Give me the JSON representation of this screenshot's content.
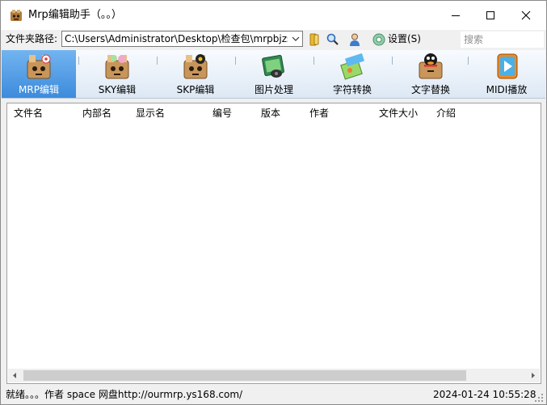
{
  "window": {
    "title": "Mrp编辑助手（。。）",
    "icon": "mrp-app-icon"
  },
  "pathbar": {
    "label": "文件夹路径:",
    "path_value": "C:\\Users\\Administrator\\Desktop\\检查包\\mrpbjzs",
    "settings_label": "设置(S)",
    "search_placeholder": "搜索"
  },
  "toolbar": {
    "items": [
      {
        "label": "MRP编辑",
        "icon": "mrp-edit-icon",
        "active": true
      },
      {
        "label": "SKY编辑",
        "icon": "sky-edit-icon",
        "active": false
      },
      {
        "label": "SKP编辑",
        "icon": "skp-edit-icon",
        "active": false
      },
      {
        "label": "图片处理",
        "icon": "image-process-icon",
        "active": false
      },
      {
        "label": "字符转换",
        "icon": "char-convert-icon",
        "active": false
      },
      {
        "label": "文字替换",
        "icon": "text-replace-icon",
        "active": false
      },
      {
        "label": "MIDI播放",
        "icon": "midi-play-icon",
        "active": false
      }
    ]
  },
  "list": {
    "columns": [
      "文件名",
      "内部名",
      "显示名",
      "编号",
      "版本",
      "作者",
      "文件大小",
      "介绍"
    ],
    "rows": []
  },
  "status": {
    "text": "就绪。。。作者 space 网盘http://ourmrp.ys168.com/",
    "datetime": "2024-01-24 10:55:28"
  },
  "colors": {
    "active_tab": "#3d8bdc",
    "toolbar_bg": "#dde8f4"
  }
}
